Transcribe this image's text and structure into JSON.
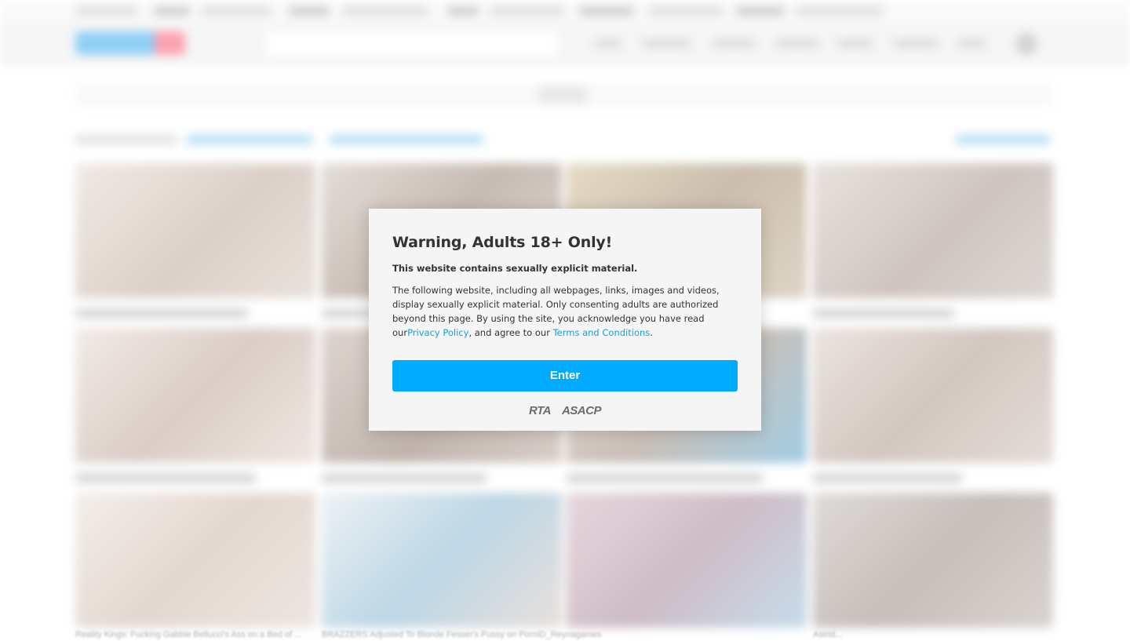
{
  "modal": {
    "title": "Warning, Adults 18+ Only!",
    "subtitle": "This website contains sexually explicit material.",
    "body_intro": "The following website, including all webpages, links, images and videos, display sexually explicit material. Only consenting adults are authorized beyond this page. By using the site, you acknowledge you have read our",
    "privacy_link": "Privacy Policy",
    "body_middle": ", and agree to our ",
    "terms_link": "Terms and Conditions",
    "body_end": ".",
    "enter_label": "Enter",
    "badges": [
      "RTA",
      "ASACP"
    ]
  },
  "background": {
    "thumbnail_titles": [
      "Reality Kings: Fucking Gabbie Bellucci's Ass on a Bed of ...",
      "BRAZZERS Adjusted To Blonde Fesser's Pussy on PornID_Reynagames",
      "Astrid..."
    ]
  },
  "colors": {
    "accent": "#00aaff",
    "link": "#1a9fd6",
    "modal_bg": "#f5f5f5",
    "text": "#333333"
  }
}
